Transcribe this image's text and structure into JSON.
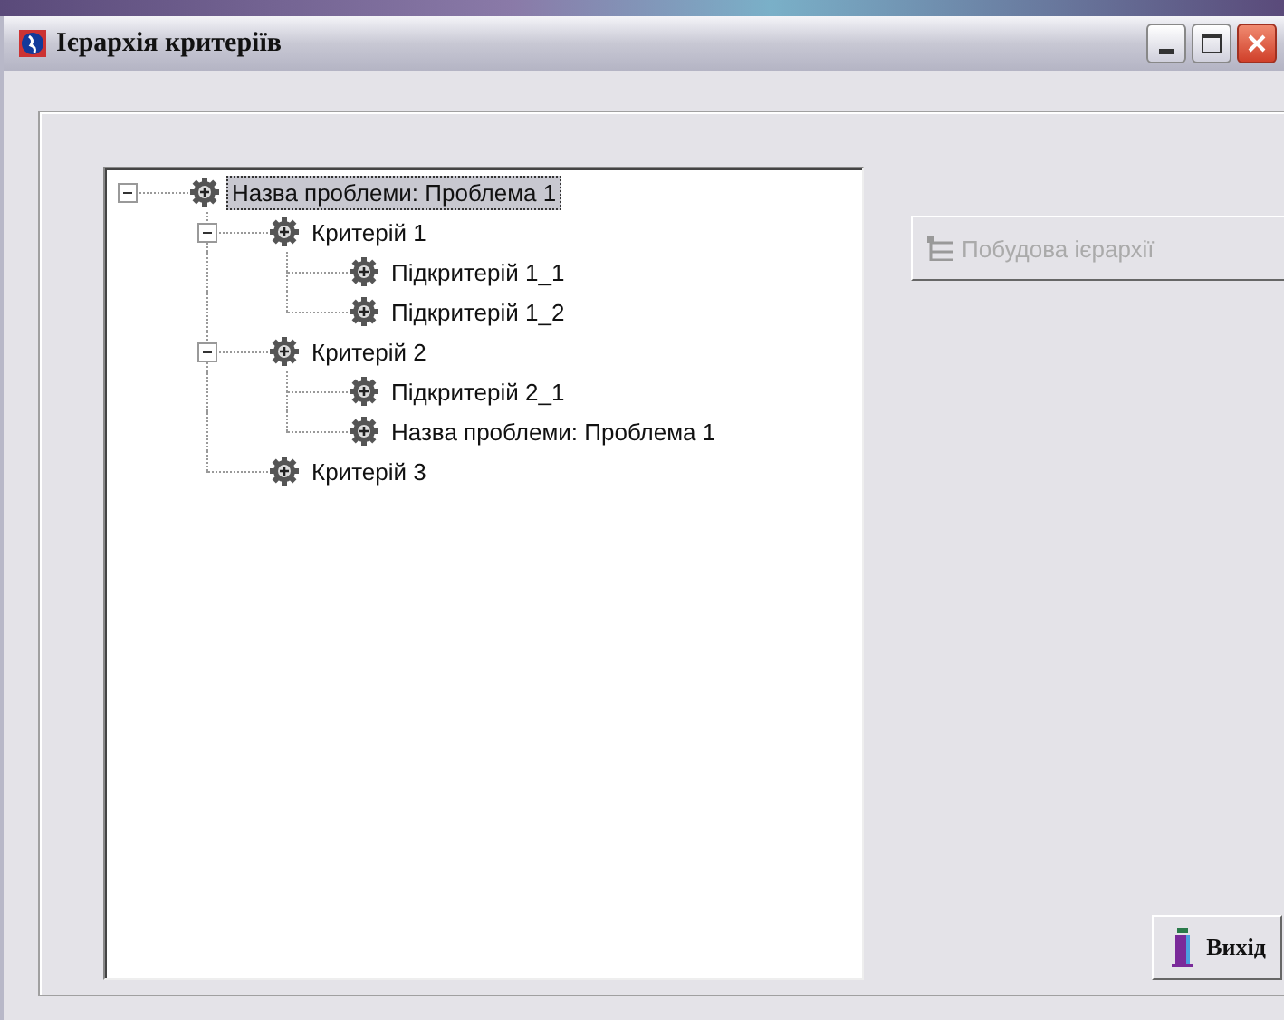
{
  "window": {
    "title": "Ієрархія критеріїв"
  },
  "tree": [
    {
      "label": "Назва проблеми:  Проблема 1",
      "selected": true,
      "expanded": true,
      "children": [
        {
          "label": "Критерій 1",
          "selected": false,
          "expanded": true,
          "children": [
            {
              "label": "Підкритерій 1_1",
              "selected": false
            },
            {
              "label": "Підкритерій 1_2",
              "selected": false
            }
          ]
        },
        {
          "label": "Критерій 2",
          "selected": false,
          "expanded": true,
          "children": [
            {
              "label": "Підкритерій 2_1",
              "selected": false
            },
            {
              "label": "Назва проблеми:  Проблема 1",
              "selected": false
            }
          ]
        },
        {
          "label": "Критерій 3",
          "selected": false
        }
      ]
    }
  ],
  "buttons": [
    {
      "kind": "build",
      "label": "Побудова ієрархії",
      "disabled": true
    },
    {
      "kind": "exit",
      "label": "Вихід",
      "disabled": false
    }
  ]
}
